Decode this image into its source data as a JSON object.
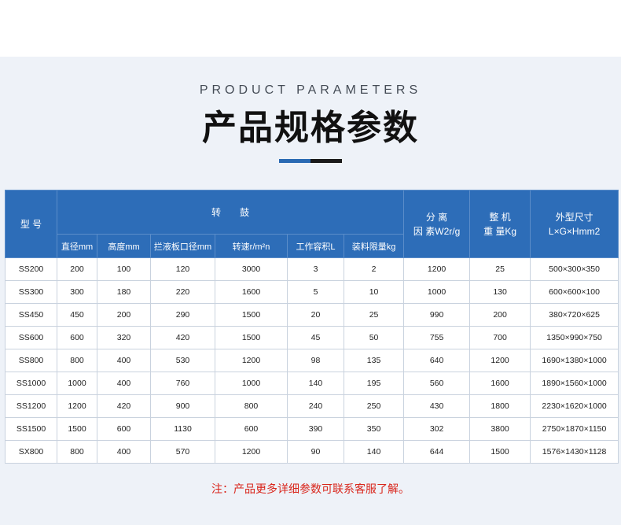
{
  "header": {
    "subtitle": "PRODUCT PARAMETERS",
    "title": "产品规格参数"
  },
  "colors": {
    "accent_blue": "#2d6db8",
    "divider_dark": "#1a1a1a",
    "note_red": "#d9261c"
  },
  "table": {
    "head": {
      "model": "型 号",
      "drum": "转　　鼓",
      "separation_l1": "分 离",
      "separation_l2": "因 素W2r/g",
      "weight_l1": "整 机",
      "weight_l2": "重 量Kg",
      "size_l1": "外型尺寸",
      "size_l2": "L×G×Hmm2",
      "sub": [
        "直径mm",
        "高度mm",
        "拦液板口径mm",
        "转速r/m²n",
        "工作容积L",
        "装料限量kg"
      ]
    },
    "rows": [
      [
        "SS200",
        "200",
        "100",
        "120",
        "3000",
        "3",
        "2",
        "1200",
        "25",
        "500×300×350"
      ],
      [
        "SS300",
        "300",
        "180",
        "220",
        "1600",
        "5",
        "10",
        "1000",
        "130",
        "600×600×100"
      ],
      [
        "SS450",
        "450",
        "200",
        "290",
        "1500",
        "20",
        "25",
        "990",
        "200",
        "380×720×625"
      ],
      [
        "SS600",
        "600",
        "320",
        "420",
        "1500",
        "45",
        "50",
        "755",
        "700",
        "1350×990×750"
      ],
      [
        "SS800",
        "800",
        "400",
        "530",
        "1200",
        "98",
        "135",
        "640",
        "1200",
        "1690×1380×1000"
      ],
      [
        "SS1000",
        "1000",
        "400",
        "760",
        "1000",
        "140",
        "195",
        "560",
        "1600",
        "1890×1560×1000"
      ],
      [
        "SS1200",
        "1200",
        "420",
        "900",
        "800",
        "240",
        "250",
        "430",
        "1800",
        "2230×1620×1000"
      ],
      [
        "SS1500",
        "1500",
        "600",
        "1130",
        "600",
        "390",
        "350",
        "302",
        "3800",
        "2750×1870×1150"
      ],
      [
        "SX800",
        "800",
        "400",
        "570",
        "1200",
        "90",
        "140",
        "644",
        "1500",
        "1576×1430×1128"
      ]
    ]
  },
  "note": "注：产品更多详细参数可联系客服了解。"
}
